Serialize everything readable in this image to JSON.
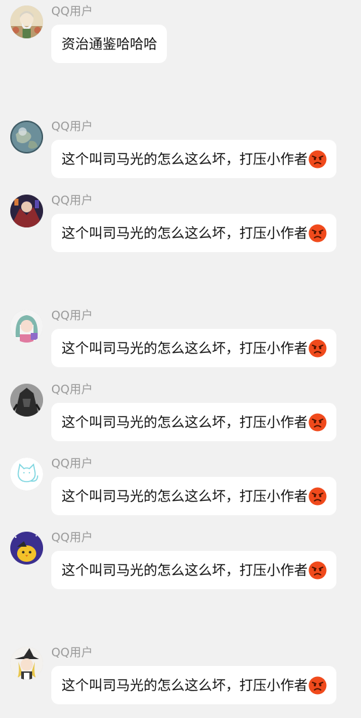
{
  "messages": [
    {
      "user": "QQ用户",
      "text": "资治通鉴哈哈哈",
      "emoji": null,
      "avatar_icon": "old-sage-avatar"
    },
    {
      "user": "QQ用户",
      "text": "这个叫司马光的怎么这么坏，打压小作者",
      "emoji": "angry-face-emoji",
      "avatar_icon": "earth-globe-avatar"
    },
    {
      "user": "QQ用户",
      "text": "这个叫司马光的怎么这么坏，打压小作者",
      "emoji": "angry-face-emoji",
      "avatar_icon": "anime-character-avatar"
    },
    {
      "user": "QQ用户",
      "text": "这个叫司马光的怎么这么坏，打压小作者",
      "emoji": "angry-face-emoji",
      "avatar_icon": "teal-hair-girl-avatar"
    },
    {
      "user": "QQ用户",
      "text": "这个叫司马光的怎么这么坏，打压小作者",
      "emoji": "angry-face-emoji",
      "avatar_icon": "dark-armor-avatar"
    },
    {
      "user": "QQ用户",
      "text": "这个叫司马光的怎么这么坏，打压小作者",
      "emoji": "angry-face-emoji",
      "avatar_icon": "cyan-cat-sketch-avatar"
    },
    {
      "user": "QQ用户",
      "text": "这个叫司马光的怎么这么坏，打压小作者",
      "emoji": "angry-face-emoji",
      "avatar_icon": "yellow-chick-avatar"
    },
    {
      "user": "QQ用户",
      "text": "这个叫司马光的怎么这么坏，打压小作者",
      "emoji": "angry-face-emoji",
      "avatar_icon": "witch-girl-avatar"
    }
  ]
}
